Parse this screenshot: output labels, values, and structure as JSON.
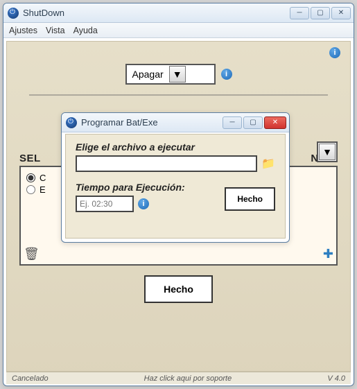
{
  "main": {
    "title": "ShutDown",
    "menu": {
      "ajustes": "Ajustes",
      "vista": "Vista",
      "ayuda": "Ayuda"
    },
    "action_dropdown": {
      "value": "Apagar"
    },
    "section_left": "SEL",
    "section_right": "NER:",
    "radio_opt1": "C",
    "radio_opt2": "E",
    "done_button": "Hecho",
    "status_left": "Cancelado",
    "status_center": "Haz click aqui por soporte",
    "status_right": "V 4.0"
  },
  "dialog": {
    "title": "Programar Bat/Exe",
    "file_label": "Elige el archivo a ejecutar",
    "file_value": "",
    "time_label": "Tiempo para Ejecución:",
    "time_placeholder": "Ej. 02:30",
    "time_value": "",
    "done_button": "Hecho"
  },
  "hidden_dropdown": {
    "value": ""
  }
}
